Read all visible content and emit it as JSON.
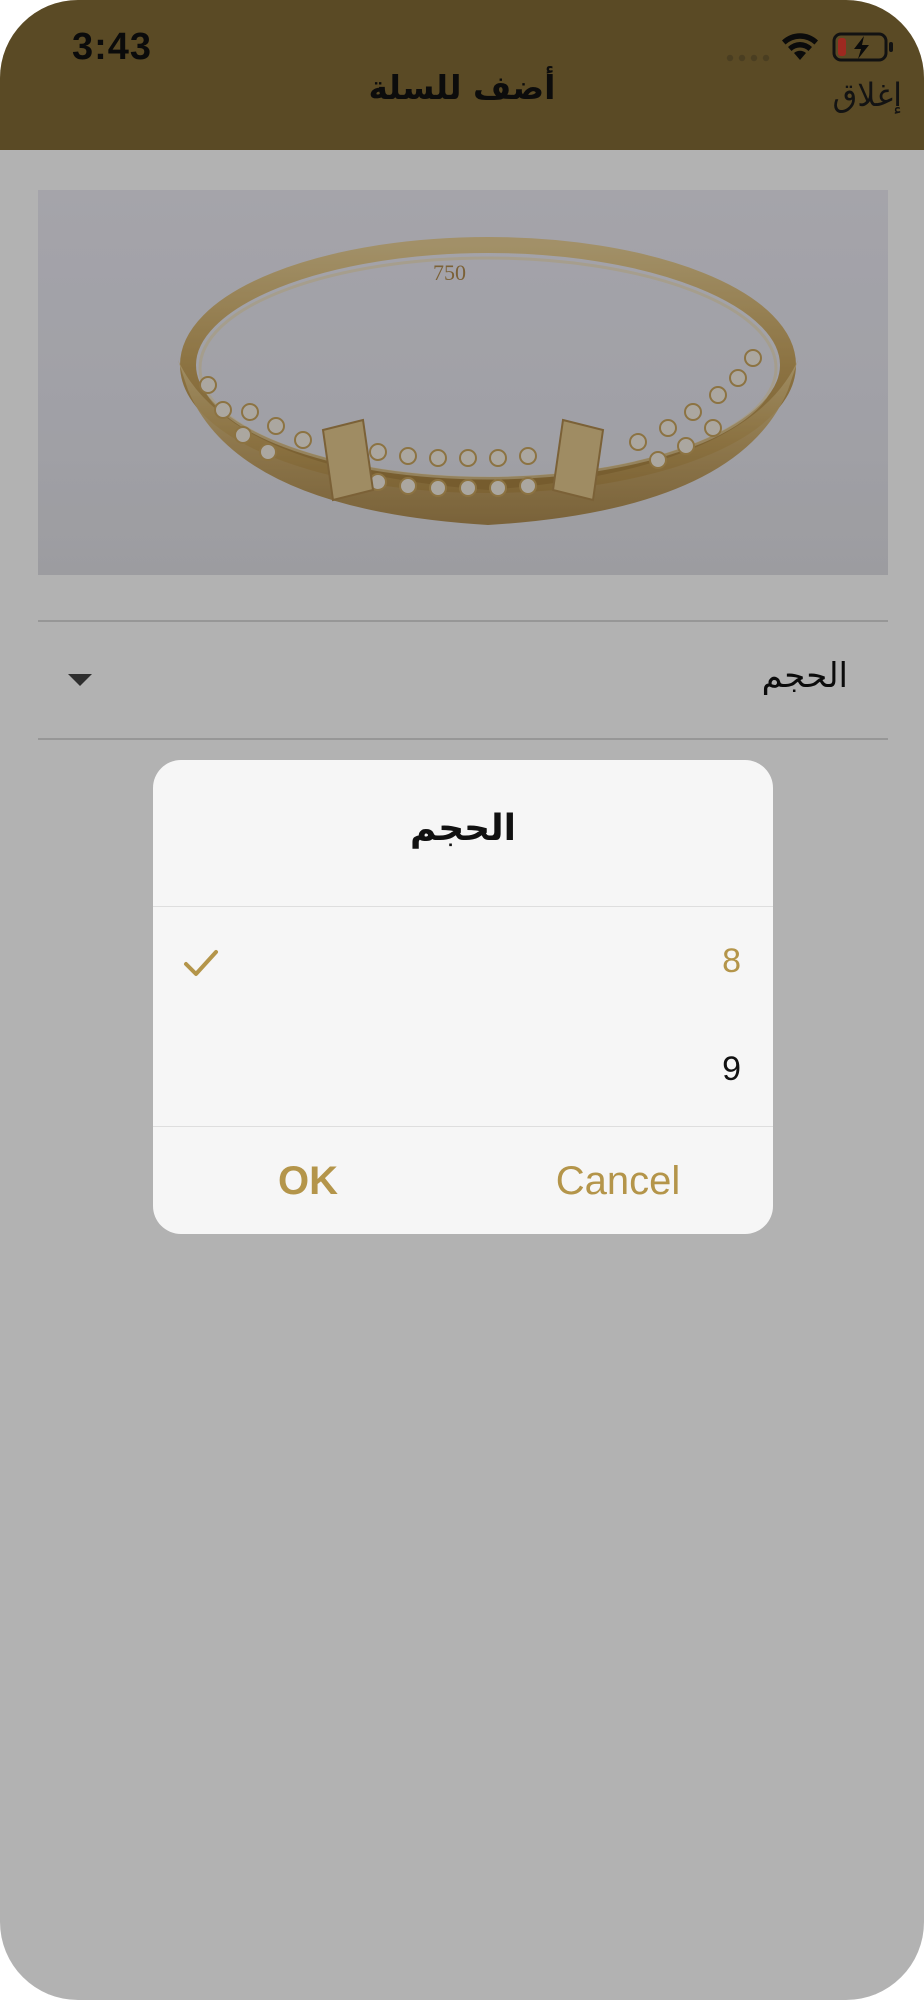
{
  "status_bar": {
    "time": "3:43"
  },
  "header": {
    "title": "أضف للسلة",
    "close_label": "إغلاق",
    "background_color": "#826b36"
  },
  "product": {
    "image_hallmark": "750"
  },
  "size_selector": {
    "label": "الحجم"
  },
  "dialog": {
    "title": "الحجم",
    "options": [
      {
        "value": "8",
        "selected": true
      },
      {
        "value": "9",
        "selected": false
      }
    ],
    "ok_label": "OK",
    "cancel_label": "Cancel",
    "accent_color": "#b4954a"
  }
}
